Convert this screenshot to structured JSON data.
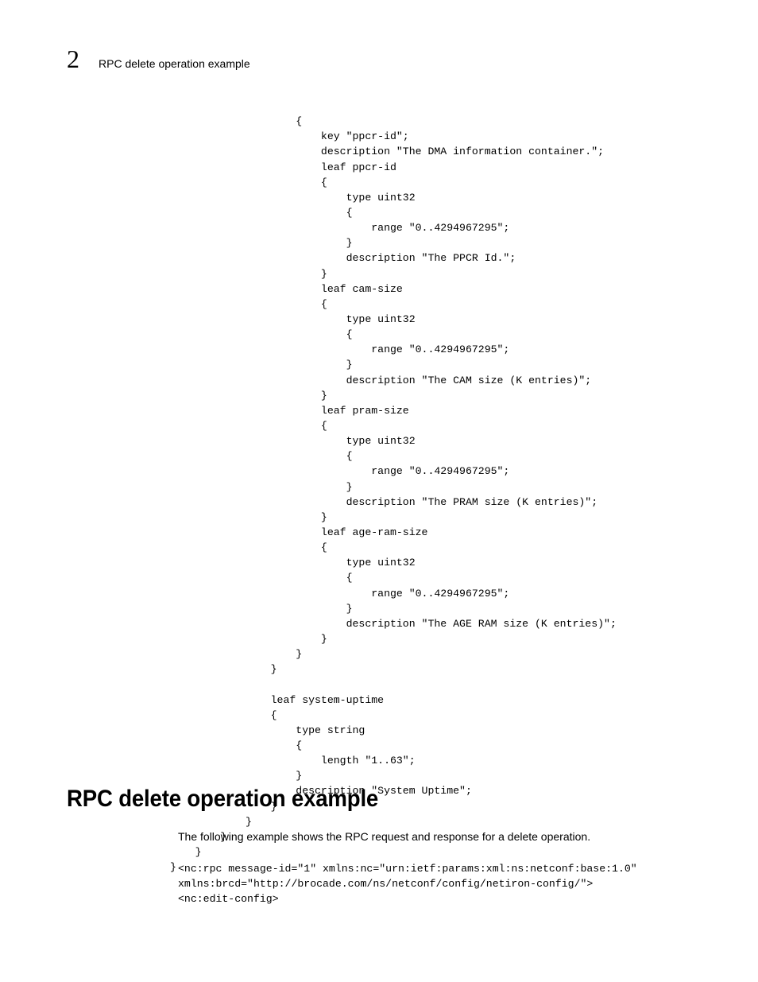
{
  "header": {
    "chapter_number": "2",
    "running_head": "RPC delete operation example"
  },
  "code_block_1": "                    {\n                        key \"ppcr-id\";\n                        description \"The DMA information container.\";\n                        leaf ppcr-id\n                        {\n                            type uint32\n                            {\n                                range \"0..4294967295\";\n                            }\n                            description \"The PPCR Id.\";\n                        }\n                        leaf cam-size\n                        {\n                            type uint32\n                            {\n                                range \"0..4294967295\";\n                            }\n                            description \"The CAM size (K entries)\";\n                        }\n                        leaf pram-size\n                        {\n                            type uint32\n                            {\n                                range \"0..4294967295\";\n                            }\n                            description \"The PRAM size (K entries)\";\n                        }\n                        leaf age-ram-size\n                        {\n                            type uint32\n                            {\n                                range \"0..4294967295\";\n                            }\n                            description \"The AGE RAM size (K entries)\";\n                        }\n                    }\n                }\n\n                leaf system-uptime\n                {\n                    type string\n                    {\n                        length \"1..63\";\n                    }\n                    description \"System Uptime\";\n                }\n            }\n        }\n    }\n}",
  "heading": "RPC delete operation example",
  "body_paragraph": "The following example shows the RPC request and response for a delete operation.",
  "code_block_2": "<nc:rpc message-id=\"1\" xmlns:nc=\"urn:ietf:params:xml:ns:netconf:base:1.0\" \nxmlns:brcd=\"http://brocade.com/ns/netconf/config/netiron-config/\">\n<nc:edit-config>"
}
